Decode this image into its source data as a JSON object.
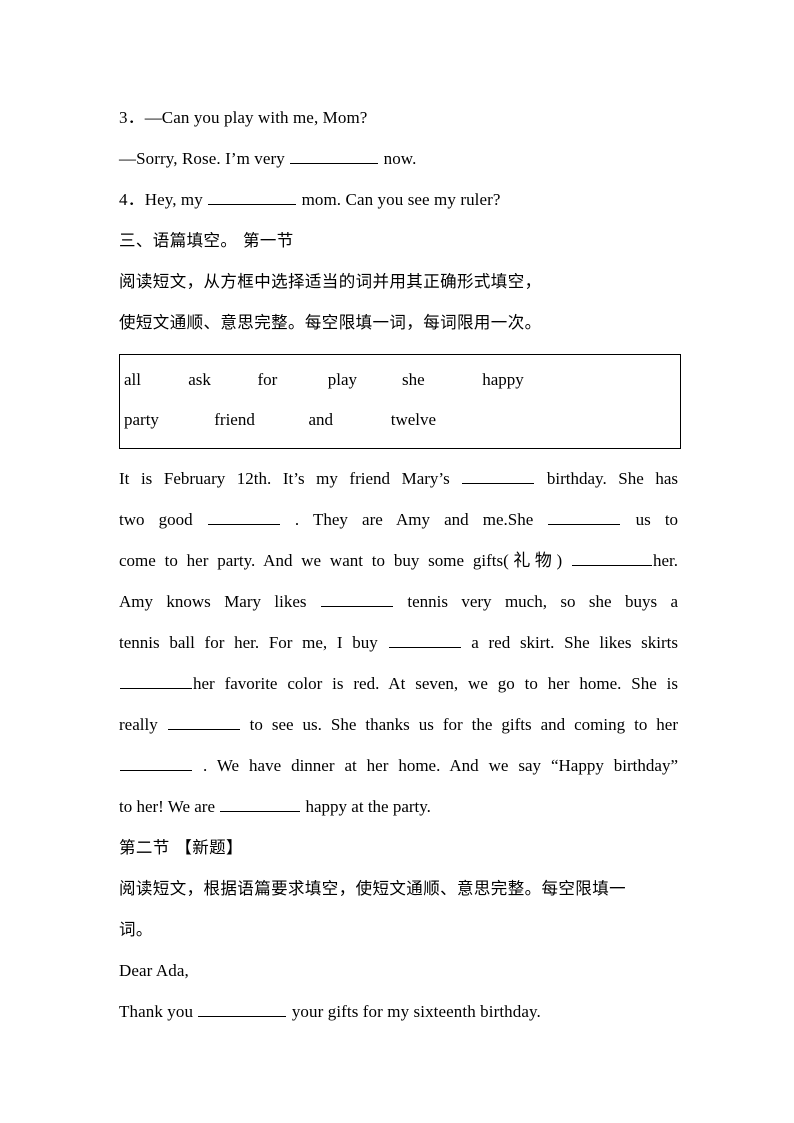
{
  "document": {
    "type": "english-worksheet",
    "page_background": "#ffffff",
    "text_color": "#000000"
  },
  "section_fill_in": {
    "item3_line1": "3．—Can you play with me, Mom?",
    "item3_line2_before": "—Sorry, Rose. I’m very",
    "item3_line2_after": "now.",
    "item4_before": "4．Hey, my",
    "item4_after": "mom. Can you see my ruler?"
  },
  "section_three": {
    "heading": "三、语篇填空。 第一节",
    "instruction_line1": "阅读短文，从方框中选择适当的词并用其正确形式填空，",
    "instruction_line2": "使短文通顺、意思完整。每空限填一词，每词限用一次。"
  },
  "word_bank": {
    "row1": [
      "all",
      "ask",
      "for",
      "play",
      "she",
      "happy"
    ],
    "row2": [
      "party",
      "friend",
      "and",
      "twelve"
    ]
  },
  "passage": {
    "l1_a": "It is February 12th. It’s my friend Mary’s",
    "l1_b": "birthday. She has",
    "l2_a": "two good",
    "l2_b": ". They are Amy and me.She",
    "l2_c": "us to",
    "l3_a": "come to her party. And we want to buy some gifts(礼物)",
    "l3_b": "her.",
    "l4_a": "Amy knows Mary likes",
    "l4_b": "tennis very much, so she buys a",
    "l5_a": "tennis ball for her. For me, I buy",
    "l5_b": "a red skirt. She likes skirts",
    "l6_a": "",
    "l6_b": "her favorite color is red. At seven, we go to her home. She is",
    "l7_a": "really",
    "l7_b": "to see us. She thanks us for the gifts and coming to her",
    "l8_a": "",
    "l8_b": ". We have dinner at her home. And we say “Happy birthday”",
    "l9_a": "to her! We are",
    "l9_b": "happy at the party."
  },
  "section_two": {
    "heading": "第二节 【新题】",
    "instruction_line1": "阅读短文，根据语篇要求填空，使短文通顺、意思完整。每空限填一",
    "instruction_line2": "词。"
  },
  "letter": {
    "salutation": "Dear Ada,",
    "line1_a": "Thank you",
    "line1_b": "your gifts for my sixteenth birthday."
  }
}
